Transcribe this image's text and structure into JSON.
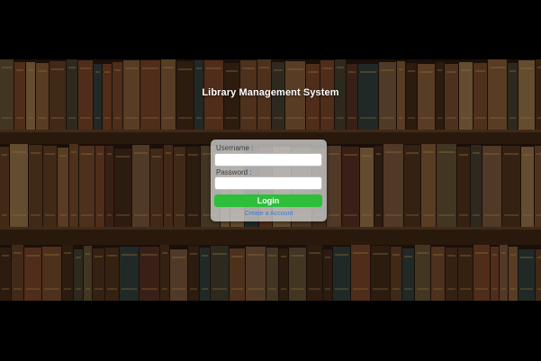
{
  "page": {
    "title": "Library Management System"
  },
  "login_form": {
    "username_label": "Username :",
    "username_value": "",
    "password_label": "Password :",
    "password_value": "",
    "login_button_label": "Login",
    "create_account_link": "Create a Account"
  },
  "colors": {
    "page_background": "#000000",
    "login_button": "#2ebf3a",
    "link": "#3a7bd5",
    "card_background": "#c8c8c8"
  }
}
